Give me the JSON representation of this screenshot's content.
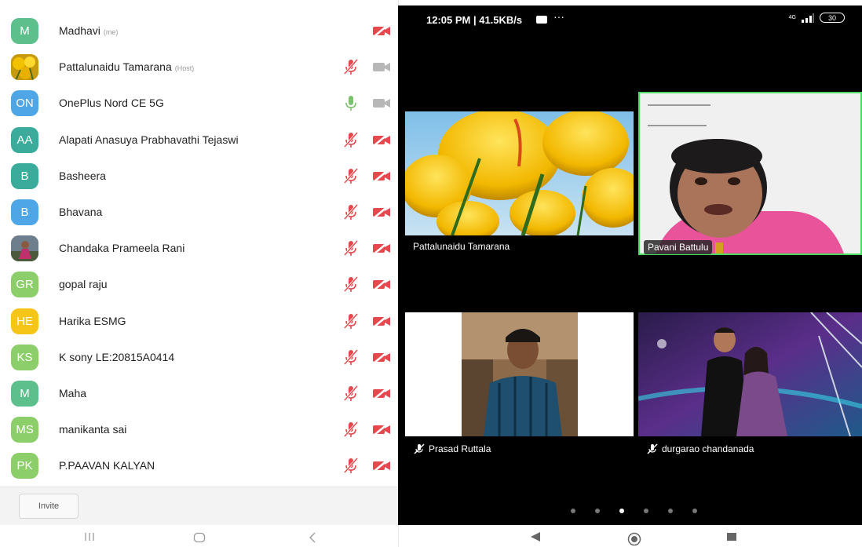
{
  "participants": [
    {
      "initials": "M",
      "name": "Madhavi",
      "tag": "(me)",
      "color": "#5cbf8c",
      "mic": "none",
      "cam": "off",
      "photo": ""
    },
    {
      "initials": "",
      "name": "Pattalunaidu Tamarana",
      "tag": "(Host)",
      "color": "#d9a500",
      "mic": "muted",
      "cam": "on",
      "photo": "tulip"
    },
    {
      "initials": "ON",
      "name": "OnePlus Nord CE 5G",
      "tag": "",
      "color": "#4fa6e6",
      "mic": "active",
      "cam": "on",
      "photo": ""
    },
    {
      "initials": "AA",
      "name": "Alapati Anasuya Prabhavathi Tejaswi",
      "tag": "",
      "color": "#3bab9b",
      "mic": "muted",
      "cam": "off",
      "photo": ""
    },
    {
      "initials": "B",
      "name": "Basheera",
      "tag": "",
      "color": "#3bab9b",
      "mic": "muted",
      "cam": "off",
      "photo": ""
    },
    {
      "initials": "B",
      "name": "Bhavana",
      "tag": "",
      "color": "#4fa6e6",
      "mic": "muted",
      "cam": "off",
      "photo": ""
    },
    {
      "initials": "",
      "name": "Chandaka Prameela Rani",
      "tag": "",
      "color": "#7a6a8a",
      "mic": "muted",
      "cam": "off",
      "photo": "person"
    },
    {
      "initials": "GR",
      "name": "gopal raju",
      "tag": "",
      "color": "#8ccf6a",
      "mic": "muted",
      "cam": "off",
      "photo": ""
    },
    {
      "initials": "HE",
      "name": "Harika ESMG",
      "tag": "",
      "color": "#f5c518",
      "mic": "muted",
      "cam": "off",
      "photo": ""
    },
    {
      "initials": "KS",
      "name": "K sony LE:20815A0414",
      "tag": "",
      "color": "#8ccf6a",
      "mic": "muted",
      "cam": "off",
      "photo": ""
    },
    {
      "initials": "M",
      "name": "Maha",
      "tag": "",
      "color": "#5cbf8c",
      "mic": "muted",
      "cam": "off",
      "photo": ""
    },
    {
      "initials": "MS",
      "name": "manikanta sai",
      "tag": "",
      "color": "#8ccf6a",
      "mic": "muted",
      "cam": "off",
      "photo": ""
    },
    {
      "initials": "PK",
      "name": "P.PAAVAN KALYAN",
      "tag": "",
      "color": "#8ccf6a",
      "mic": "muted",
      "cam": "off",
      "photo": ""
    }
  ],
  "invite_label": "Invite",
  "status": {
    "time": "12:05 PM | 41.5KB/s",
    "battery": "30",
    "network": "4G"
  },
  "tiles": [
    {
      "name": "Pattalunaidu Tamarana",
      "muted": false
    },
    {
      "name": "Pavani Battulu",
      "muted": false,
      "active_speaker": true
    },
    {
      "name": "Prasad Ruttala",
      "muted": true
    },
    {
      "name": "durgarao chandanada",
      "muted": true
    }
  ],
  "page_dots": {
    "count": 6,
    "active_index": 2
  },
  "colors": {
    "muted_red": "#e5484d",
    "active_green": "#7cc16b",
    "speaker_border": "#4cd964",
    "cam_grey": "#b7b7b7"
  }
}
